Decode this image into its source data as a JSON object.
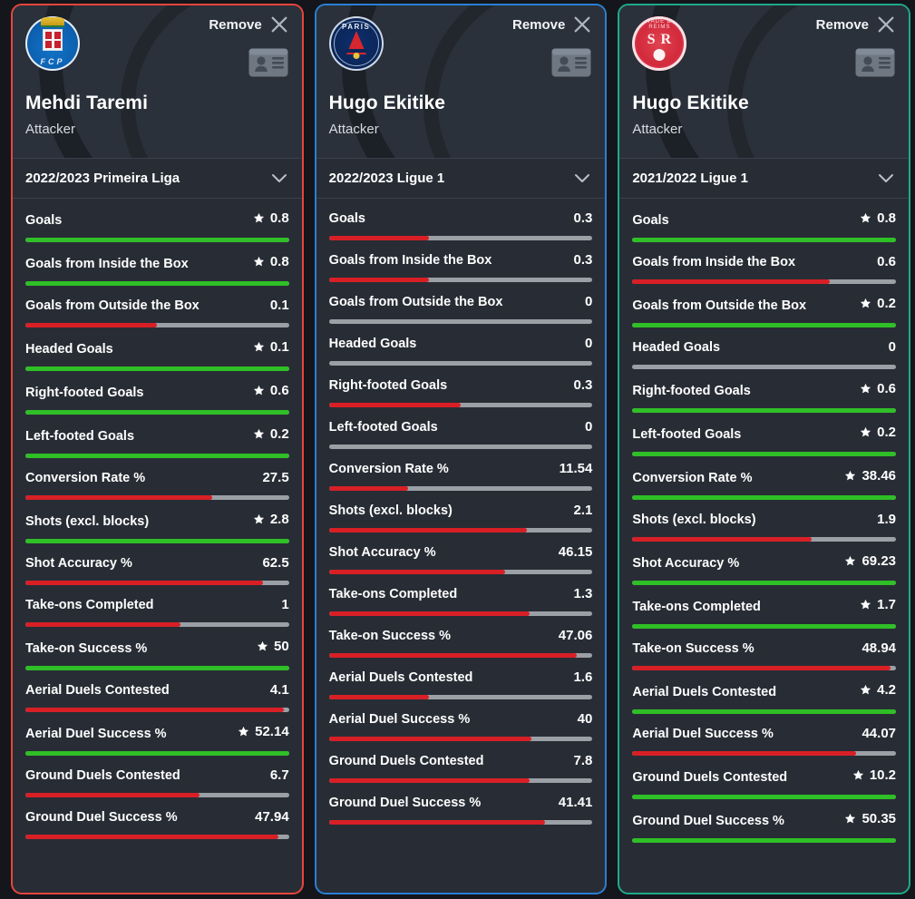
{
  "icons": {
    "remove": "close-x-icon",
    "profile": "id-card-icon",
    "dropdown": "chevron-down-icon",
    "best": "star-icon"
  },
  "colors": {
    "accent_card1": "#e8453c",
    "accent_card2": "#2a7fd4",
    "accent_card3": "#1ea98a",
    "bar_good": "#2fbf26",
    "bar_bad": "#d81f26",
    "bar_track": "#9aa0a6",
    "card_bg": "#282d35",
    "page_bg": "#14161b"
  },
  "cards": [
    {
      "accent": "accent-red",
      "crest": "fc-porto-crest",
      "remove_label": "Remove",
      "player_name": "Mehdi Taremi",
      "player_role": "Attacker",
      "season": "2022/2023 Primeira Liga",
      "stats": [
        {
          "name": "Goals",
          "value": "0.8",
          "star": true,
          "pct": 100,
          "tone": "good"
        },
        {
          "name": "Goals from Inside the Box",
          "value": "0.8",
          "star": true,
          "pct": 100,
          "tone": "good"
        },
        {
          "name": "Goals from Outside the Box",
          "value": "0.1",
          "star": false,
          "pct": 50,
          "tone": "bad"
        },
        {
          "name": "Headed Goals",
          "value": "0.1",
          "star": true,
          "pct": 100,
          "tone": "good"
        },
        {
          "name": "Right-footed Goals",
          "value": "0.6",
          "star": true,
          "pct": 100,
          "tone": "good"
        },
        {
          "name": "Left-footed Goals",
          "value": "0.2",
          "star": true,
          "pct": 100,
          "tone": "good"
        },
        {
          "name": "Conversion Rate %",
          "value": "27.5",
          "star": false,
          "pct": 71,
          "tone": "bad"
        },
        {
          "name": "Shots (excl. blocks)",
          "value": "2.8",
          "star": true,
          "pct": 100,
          "tone": "good"
        },
        {
          "name": "Shot Accuracy %",
          "value": "62.5",
          "star": false,
          "pct": 90,
          "tone": "bad"
        },
        {
          "name": "Take-ons Completed",
          "value": "1",
          "star": false,
          "pct": 59,
          "tone": "bad"
        },
        {
          "name": "Take-on Success %",
          "value": "50",
          "star": true,
          "pct": 100,
          "tone": "good"
        },
        {
          "name": "Aerial Duels Contested",
          "value": "4.1",
          "star": false,
          "pct": 98,
          "tone": "bad"
        },
        {
          "name": "Aerial Duel Success %",
          "value": "52.14",
          "star": true,
          "pct": 100,
          "tone": "good"
        },
        {
          "name": "Ground Duels Contested",
          "value": "6.7",
          "star": false,
          "pct": 66,
          "tone": "bad"
        },
        {
          "name": "Ground Duel Success %",
          "value": "47.94",
          "star": false,
          "pct": 96,
          "tone": "bad"
        }
      ]
    },
    {
      "accent": "accent-blue",
      "crest": "paris-saint-germain-crest",
      "remove_label": "Remove",
      "player_name": "Hugo Ekitike",
      "player_role": "Attacker",
      "season": "2022/2023 Ligue 1",
      "stats": [
        {
          "name": "Goals",
          "value": "0.3",
          "star": false,
          "pct": 38,
          "tone": "bad"
        },
        {
          "name": "Goals from Inside the Box",
          "value": "0.3",
          "star": false,
          "pct": 38,
          "tone": "bad"
        },
        {
          "name": "Goals from Outside the Box",
          "value": "0",
          "star": false,
          "pct": 0,
          "tone": "bad"
        },
        {
          "name": "Headed Goals",
          "value": "0",
          "star": false,
          "pct": 0,
          "tone": "bad"
        },
        {
          "name": "Right-footed Goals",
          "value": "0.3",
          "star": false,
          "pct": 50,
          "tone": "bad"
        },
        {
          "name": "Left-footed Goals",
          "value": "0",
          "star": false,
          "pct": 0,
          "tone": "bad"
        },
        {
          "name": "Conversion Rate %",
          "value": "11.54",
          "star": false,
          "pct": 30,
          "tone": "bad"
        },
        {
          "name": "Shots (excl. blocks)",
          "value": "2.1",
          "star": false,
          "pct": 75,
          "tone": "bad"
        },
        {
          "name": "Shot Accuracy %",
          "value": "46.15",
          "star": false,
          "pct": 67,
          "tone": "bad"
        },
        {
          "name": "Take-ons Completed",
          "value": "1.3",
          "star": false,
          "pct": 76,
          "tone": "bad"
        },
        {
          "name": "Take-on Success %",
          "value": "47.06",
          "star": false,
          "pct": 94,
          "tone": "bad"
        },
        {
          "name": "Aerial Duels Contested",
          "value": "1.6",
          "star": false,
          "pct": 38,
          "tone": "bad"
        },
        {
          "name": "Aerial Duel Success %",
          "value": "40",
          "star": false,
          "pct": 77,
          "tone": "bad"
        },
        {
          "name": "Ground Duels Contested",
          "value": "7.8",
          "star": false,
          "pct": 76,
          "tone": "bad"
        },
        {
          "name": "Ground Duel Success %",
          "value": "41.41",
          "star": false,
          "pct": 82,
          "tone": "bad"
        }
      ]
    },
    {
      "accent": "accent-teal",
      "crest": "stade-de-reims-crest",
      "remove_label": "Remove",
      "player_name": "Hugo Ekitike",
      "player_role": "Attacker",
      "season": "2021/2022 Ligue 1",
      "stats": [
        {
          "name": "Goals",
          "value": "0.8",
          "star": true,
          "pct": 100,
          "tone": "good"
        },
        {
          "name": "Goals from Inside the Box",
          "value": "0.6",
          "star": false,
          "pct": 75,
          "tone": "bad"
        },
        {
          "name": "Goals from Outside the Box",
          "value": "0.2",
          "star": true,
          "pct": 100,
          "tone": "good"
        },
        {
          "name": "Headed Goals",
          "value": "0",
          "star": false,
          "pct": 0,
          "tone": "bad"
        },
        {
          "name": "Right-footed Goals",
          "value": "0.6",
          "star": true,
          "pct": 100,
          "tone": "good"
        },
        {
          "name": "Left-footed Goals",
          "value": "0.2",
          "star": true,
          "pct": 100,
          "tone": "good"
        },
        {
          "name": "Conversion Rate %",
          "value": "38.46",
          "star": true,
          "pct": 100,
          "tone": "good"
        },
        {
          "name": "Shots (excl. blocks)",
          "value": "1.9",
          "star": false,
          "pct": 68,
          "tone": "bad"
        },
        {
          "name": "Shot Accuracy %",
          "value": "69.23",
          "star": true,
          "pct": 100,
          "tone": "good"
        },
        {
          "name": "Take-ons Completed",
          "value": "1.7",
          "star": true,
          "pct": 100,
          "tone": "good"
        },
        {
          "name": "Take-on Success %",
          "value": "48.94",
          "star": false,
          "pct": 98,
          "tone": "bad"
        },
        {
          "name": "Aerial Duels Contested",
          "value": "4.2",
          "star": true,
          "pct": 100,
          "tone": "good"
        },
        {
          "name": "Aerial Duel Success %",
          "value": "44.07",
          "star": false,
          "pct": 85,
          "tone": "bad"
        },
        {
          "name": "Ground Duels Contested",
          "value": "10.2",
          "star": true,
          "pct": 100,
          "tone": "good"
        },
        {
          "name": "Ground Duel Success %",
          "value": "50.35",
          "star": true,
          "pct": 100,
          "tone": "good"
        }
      ]
    }
  ]
}
